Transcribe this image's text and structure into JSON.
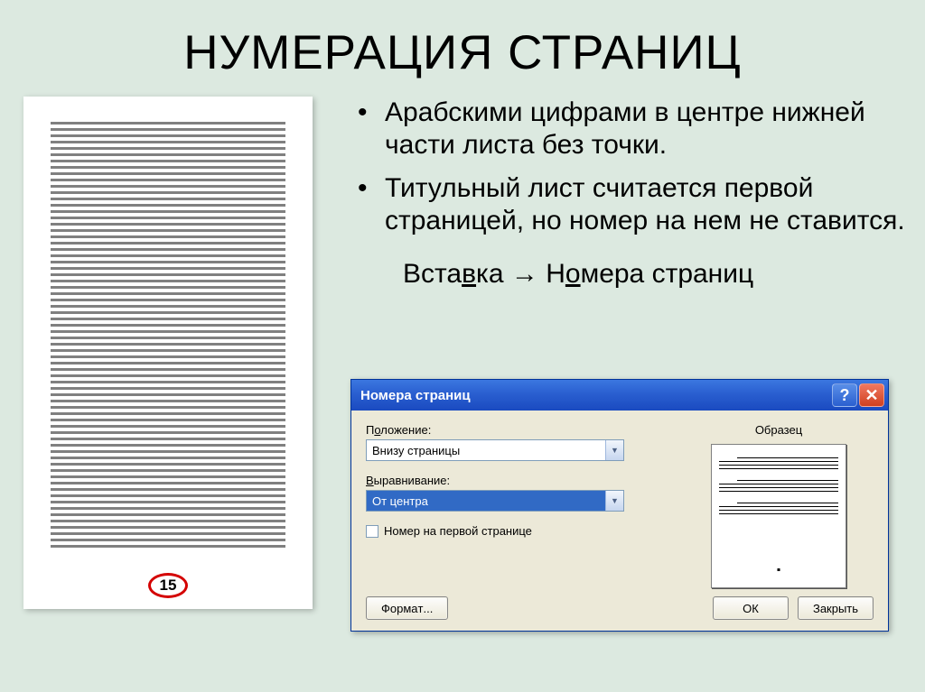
{
  "title": "НУМЕРАЦИЯ СТРАНИЦ",
  "bullets": [
    "Арабскими цифрами в центре нижней части листа без точки.",
    "Титульный лист считается первой страницей, но номер на нем не ставится."
  ],
  "menu_path": {
    "pre_v": "Вста",
    "v": "в",
    "post_v": "ка",
    "arrow": "→",
    "pre_o": " Н",
    "o": "о",
    "post_o": "мера страниц"
  },
  "page_number": "15",
  "dialog": {
    "title": "Номера страниц",
    "position_label_pre": "П",
    "position_label_u": "о",
    "position_label_post": "ложение:",
    "position_value": "Внизу страницы",
    "align_label_pre": "",
    "align_label_u": "В",
    "align_label_post": "ыравнивание:",
    "align_value": "От центра",
    "checkbox_pre": "",
    "checkbox_u": "Н",
    "checkbox_post": "омер на первой странице",
    "preview_label": "Образец",
    "btn_format_pre": "Форма",
    "btn_format_u": "т",
    "btn_format_post": "...",
    "btn_ok": "ОК",
    "btn_close": "Закрыть",
    "help": "?",
    "close": "✕"
  }
}
